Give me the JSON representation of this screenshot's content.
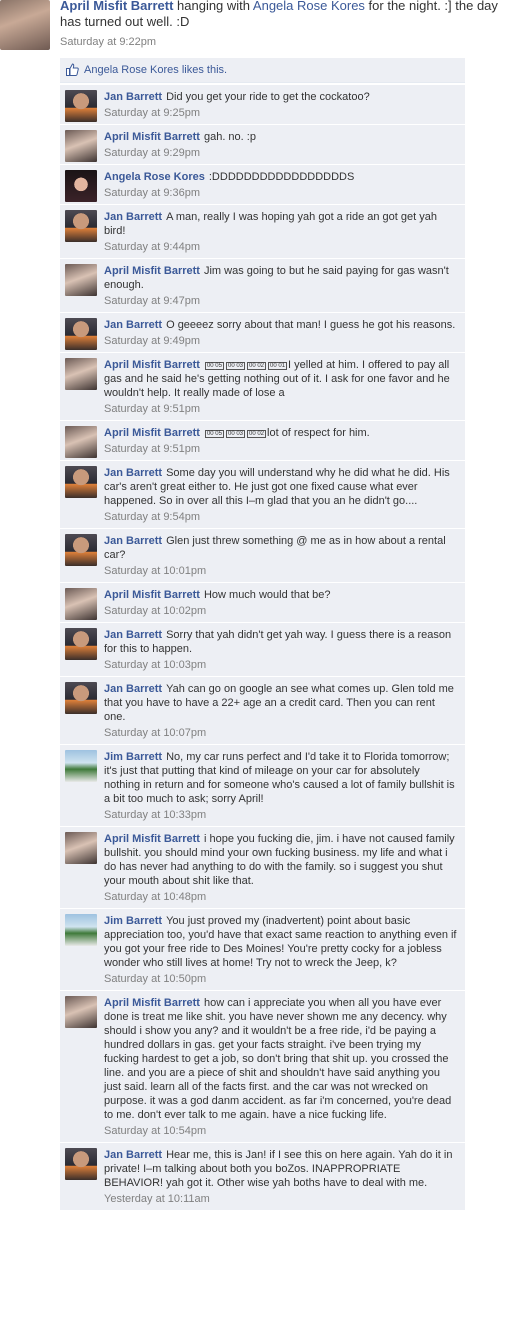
{
  "post": {
    "actor": "April Misfit Barrett",
    "text_before": " hanging with ",
    "tagged": "Angela Rose Kores",
    "text_after": " for the night. :] the day has turned out well. :D",
    "time": "Saturday at 9:22pm"
  },
  "likes": {
    "icon": "thumbs-up-icon",
    "name": "Angela Rose Kores",
    "suffix": " likes this."
  },
  "comments": [
    {
      "author": "Jan Barrett",
      "avatar": "jan",
      "prefix_glyphs": [],
      "text": "Did you get your ride to get the cockatoo?",
      "time": "Saturday at 9:25pm"
    },
    {
      "author": "April Misfit Barrett",
      "avatar": "april",
      "prefix_glyphs": [],
      "text": "gah. no. :p",
      "time": "Saturday at 9:29pm"
    },
    {
      "author": "Angela Rose Kores",
      "avatar": "angela",
      "prefix_glyphs": [],
      "text": ":DDDDDDDDDDDDDDDDDS",
      "time": "Saturday at 9:36pm"
    },
    {
      "author": "Jan Barrett",
      "avatar": "jan",
      "prefix_glyphs": [],
      "text": "A man, really I was hoping yah got a ride an got get yah bird!",
      "time": "Saturday at 9:44pm"
    },
    {
      "author": "April Misfit Barrett",
      "avatar": "april",
      "prefix_glyphs": [],
      "text": "Jim was going to but he said paying for gas wasn't enough.",
      "time": "Saturday at 9:47pm"
    },
    {
      "author": "Jan Barrett",
      "avatar": "jan",
      "prefix_glyphs": [],
      "text": "O geeeez sorry about that man! I guess he got his reasons.",
      "time": "Saturday at 9:49pm"
    },
    {
      "author": "April Misfit Barrett",
      "avatar": "april",
      "prefix_glyphs": [
        "00 05",
        "00 03",
        "00 02",
        "00 01"
      ],
      "text": "I yelled at him. I offered to pay all gas and he said he's getting nothing out of it. I ask for one favor and he wouldn't help. It really made of lose a",
      "time": "Saturday at 9:51pm"
    },
    {
      "author": "April Misfit Barrett",
      "avatar": "april",
      "prefix_glyphs": [
        "00 05",
        "00 03",
        "00 02"
      ],
      "text": "lot of respect for him.",
      "time": "Saturday at 9:51pm"
    },
    {
      "author": "Jan Barrett",
      "avatar": "jan",
      "prefix_glyphs": [],
      "text": "Some day you will understand why he did what he did. His car's aren't great either to. He just got one fixed cause what ever happened. So in over all this I–m glad that you an he didn't go....",
      "time": "Saturday at 9:54pm"
    },
    {
      "author": "Jan Barrett",
      "avatar": "jan",
      "prefix_glyphs": [],
      "text": "Glen just threw something @ me as in how about a rental car?",
      "time": "Saturday at 10:01pm"
    },
    {
      "author": "April Misfit Barrett",
      "avatar": "april",
      "prefix_glyphs": [],
      "text": "How much would that be?",
      "time": "Saturday at 10:02pm"
    },
    {
      "author": "Jan Barrett",
      "avatar": "jan",
      "prefix_glyphs": [],
      "text": "Sorry that yah didn't get yah way. I guess there is a reason for this to happen.",
      "time": "Saturday at 10:03pm"
    },
    {
      "author": "Jan Barrett",
      "avatar": "jan",
      "prefix_glyphs": [],
      "text": "Yah can go on google an see what comes up. Glen told me that you have to have a 22+ age an a credit card. Then you can rent one.",
      "time": "Saturday at 10:07pm"
    },
    {
      "author": "Jim Barrett",
      "avatar": "jim",
      "prefix_glyphs": [],
      "text": "No, my car runs perfect and I'd take it to Florida tomorrow; it's just that putting that kind of mileage on your car for absolutely nothing in return and for someone who's caused a lot of family bullshit is a bit too much to ask; sorry April!",
      "time": "Saturday at 10:33pm"
    },
    {
      "author": "April Misfit Barrett",
      "avatar": "april",
      "prefix_glyphs": [],
      "text": "i hope you fucking die, jim. i have not caused family bullshit. you should mind your own fucking business. my life and what i do has never had anything to do with the family. so i suggest you shut your mouth about shit like that.",
      "time": "Saturday at 10:48pm"
    },
    {
      "author": "Jim Barrett",
      "avatar": "jim",
      "prefix_glyphs": [],
      "text": "You just proved my (inadvertent) point about basic appreciation too, you'd have that exact same reaction to anything even if you got your free ride to Des Moines! You're pretty cocky for a jobless wonder who still lives at home! Try not to wreck the Jeep, k?",
      "time": "Saturday at 10:50pm"
    },
    {
      "author": "April Misfit Barrett",
      "avatar": "april",
      "prefix_glyphs": [],
      "text": "how can i appreciate you when all you have ever done is treat me like shit. you have never shown me any decency. why should i show you any? and it wouldn't be a free ride, i'd be paying a hundred dollars in gas. get your facts straight. i've been trying my fucking hardest to get a job, so don't bring that shit up. you crossed the line. and you are a piece of shit and shouldn't have said anything you just said. learn all of the facts first. and the car was not wrecked on purpose. it was a god danm accident. as far i'm concerned, you're dead to me. don't ever talk to me again. have a nice fucking life.",
      "time": "Saturday at 10:54pm"
    },
    {
      "author": "Jan Barrett",
      "avatar": "jan",
      "prefix_glyphs": [],
      "text": "Hear me, this is Jan! if I see this on here again. Yah do it in private! I–m talking about both you boZos. INAPPROPRIATE BEHAVIOR! yah got it. Other wise yah boths have to deal with me.",
      "time": "Yesterday at 10:11am"
    }
  ]
}
